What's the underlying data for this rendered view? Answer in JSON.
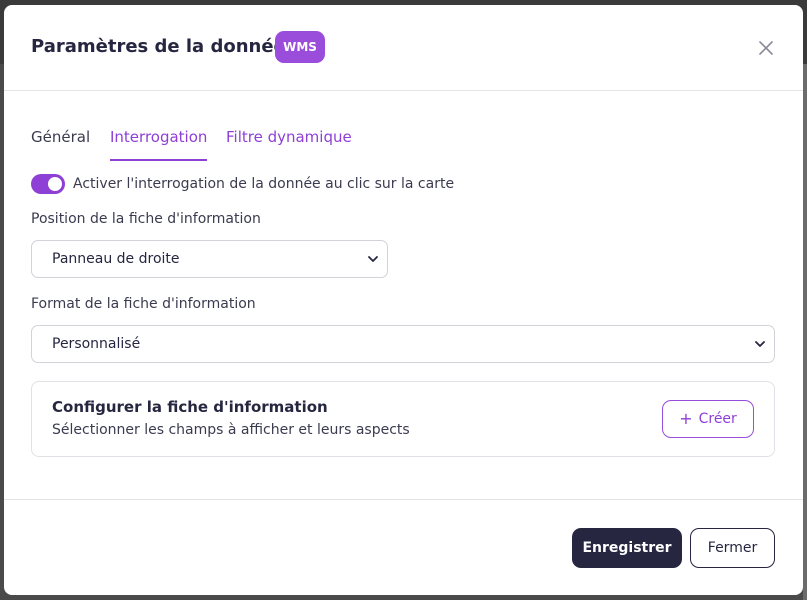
{
  "modal": {
    "title": "Paramètres de la donnée",
    "badge": "WMS",
    "close_icon": "close-icon"
  },
  "tabs": [
    {
      "label": "Général",
      "active": false
    },
    {
      "label": "Interrogation",
      "active": true
    },
    {
      "label": "Filtre dynamique",
      "active": false
    }
  ],
  "toggle": {
    "label": "Activer l'interrogation de la donnée au clic sur la carte",
    "checked": true
  },
  "position_field": {
    "label": "Position de la fiche d'information",
    "value": "Panneau de droite"
  },
  "format_field": {
    "label": "Format de la fiche d'information",
    "value": "Personnalisé"
  },
  "config_card": {
    "title": "Configurer la fiche d'information",
    "subtitle": "Sélectionner les champs à afficher et leurs aspects",
    "create_label": "Créer",
    "create_icon": "plus-icon"
  },
  "footer": {
    "save_label": "Enregistrer",
    "close_label": "Fermer"
  },
  "colors": {
    "accent": "#8e3fd6",
    "badge": "#9a4ddb",
    "dark": "#262641"
  }
}
